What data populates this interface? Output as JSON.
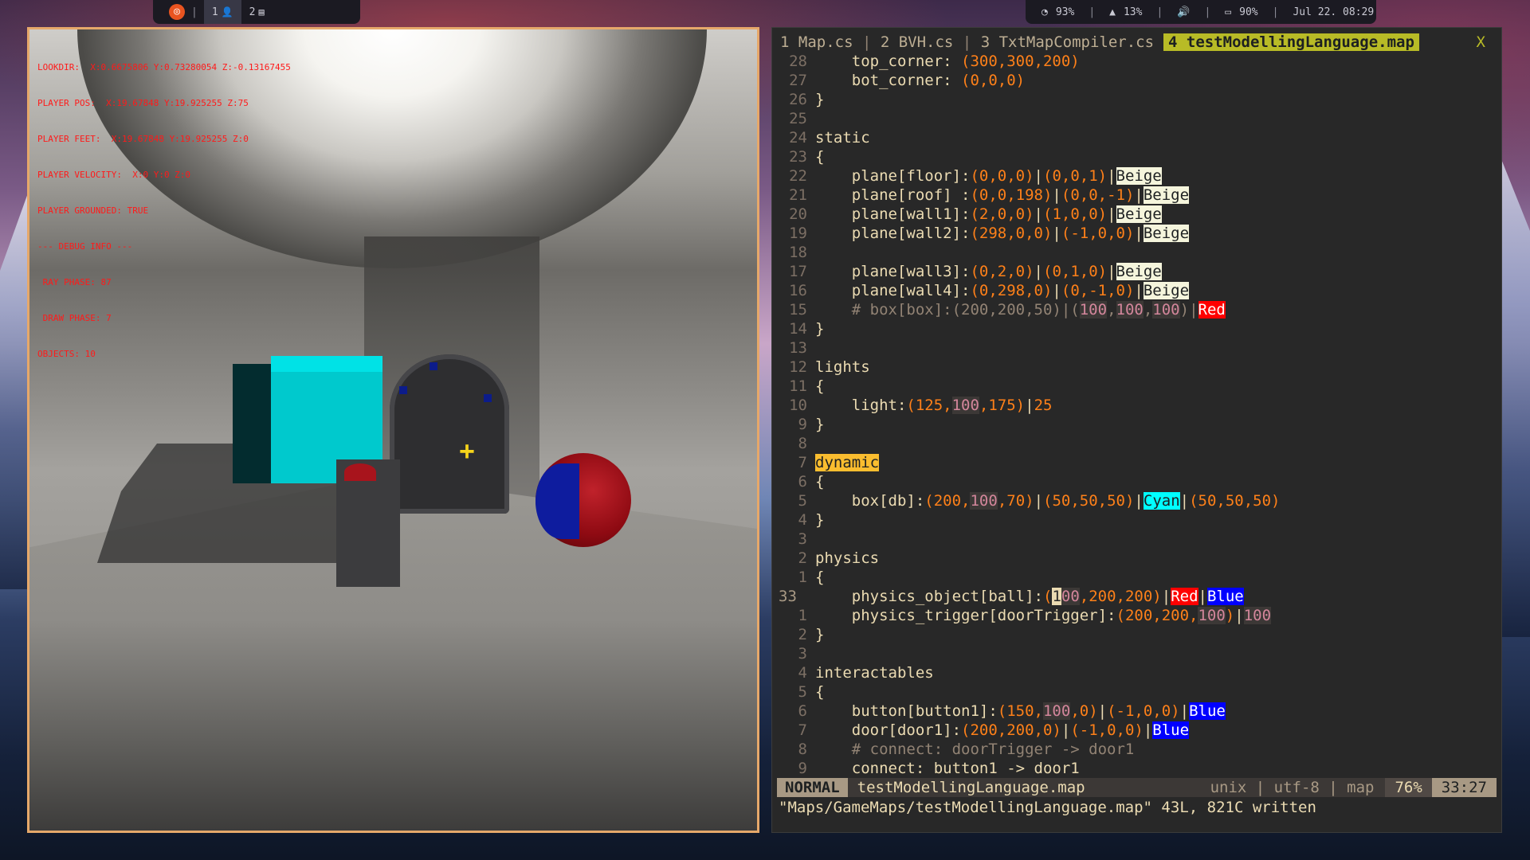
{
  "topbar": {
    "ubuntu_glyph": "◎",
    "sep": "|",
    "ws1": {
      "label": "1",
      "icon": "user-icon"
    },
    "ws2": {
      "label": "2",
      "icon": "book-icon"
    },
    "cpu": "93%",
    "mem": "13%",
    "battery": "90%",
    "datetime": "Jul 22. 08:29"
  },
  "game": {
    "debug_lines": [
      "LOOKDIR:  X:0.6675806 Y:0.73280054 Z:-0.13167455",
      "PLAYER POS:  X:19.67848 Y:19.925255 Z:75",
      "PLAYER FEET:  X:19.67848 Y:19.925255 Z:0",
      "PLAYER VELOCITY:  X:0 Y:0 Z:0",
      "PLAYER GROUNDED: TRUE",
      "--- DEBUG INFO ---",
      " RAY PHASE: 87",
      " DRAW PHASE: 7",
      "OBJECTS: 10"
    ],
    "crosshair": "+"
  },
  "editor": {
    "tabs": {
      "t1": "1 Map.cs",
      "t2": "2 BVH.cs",
      "t3": "3 TxtMapCompiler.cs",
      "active": "4 testModellingLanguage.map",
      "close": "X",
      "sep": " | "
    },
    "status": {
      "mode": "NORMAL",
      "file": "testModellingLanguage.map",
      "info": "unix | utf-8 | map",
      "percent": "76%",
      "position": "33:27"
    },
    "cmdline": "\"Maps/GameMaps/testModellingLanguage.map\" 43L, 821C written"
  },
  "accent_colors": {
    "beige": "#f5f5dc",
    "red": "#ff0000",
    "blue": "#0000ff",
    "cyan": "#00ffff",
    "frame": "#e6a86a"
  }
}
